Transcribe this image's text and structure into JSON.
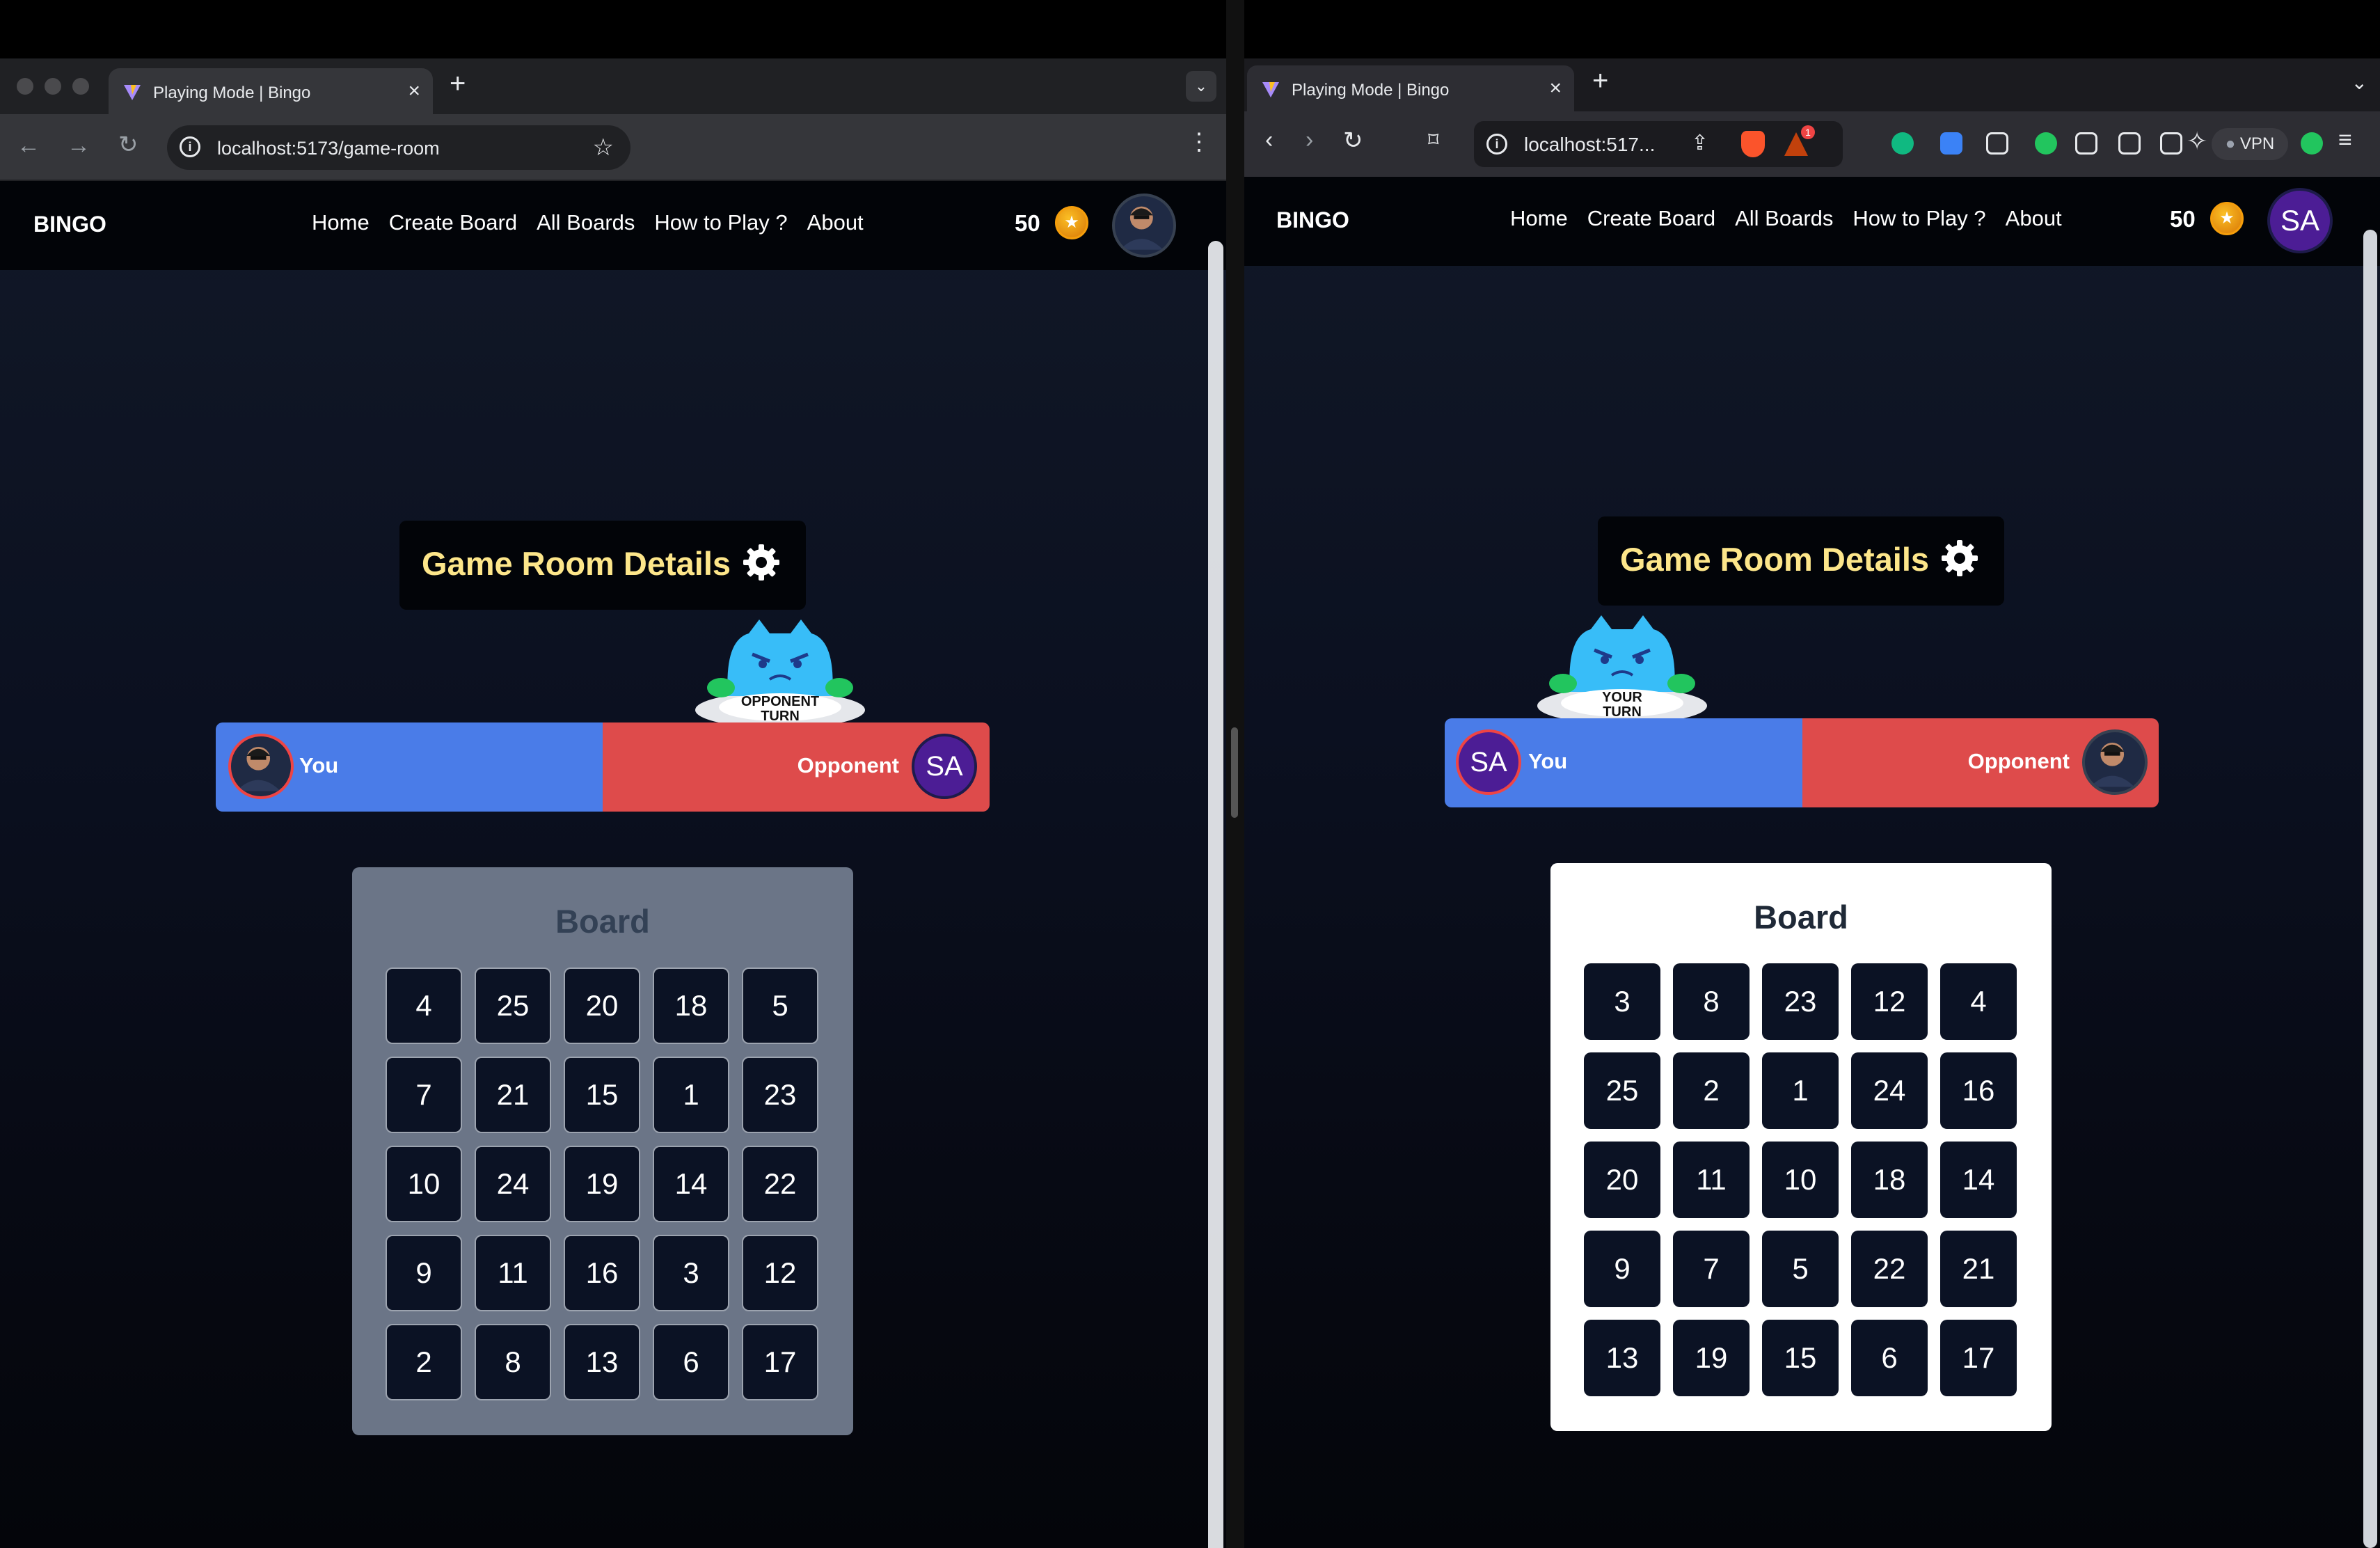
{
  "left_browser": {
    "tab_title": "Playing Mode | Bingo",
    "url": "localhost:5173/game-room"
  },
  "right_browser": {
    "tab_title": "Playing Mode | Bingo",
    "url": "localhost:517...",
    "vpn_label": "VPN",
    "notification_count": "1"
  },
  "app": {
    "brand": "BINGO",
    "nav": [
      "Home",
      "Create Board",
      "All Boards",
      "How to Play ?",
      "About"
    ],
    "coins": "50",
    "details_title": "Game Room Details",
    "you_label": "You",
    "opponent_label": "Opponent",
    "sa_initials": "SA",
    "board_title": "Board"
  },
  "left_game": {
    "turn_banner": [
      "OPPONENT",
      "TURN"
    ],
    "board": [
      4,
      25,
      20,
      18,
      5,
      7,
      21,
      15,
      1,
      23,
      10,
      24,
      19,
      14,
      22,
      9,
      11,
      16,
      3,
      12,
      2,
      8,
      13,
      6,
      17
    ]
  },
  "right_game": {
    "turn_banner": [
      "YOUR",
      "TURN"
    ],
    "board": [
      3,
      8,
      23,
      12,
      4,
      25,
      2,
      1,
      24,
      16,
      20,
      11,
      10,
      18,
      14,
      9,
      7,
      5,
      22,
      21,
      13,
      19,
      15,
      6,
      17
    ]
  },
  "colors": {
    "you": "#4a7ce8",
    "opponent": "#de4b4b",
    "title_yellow": "#fde68a",
    "cell": "#0b1224"
  }
}
